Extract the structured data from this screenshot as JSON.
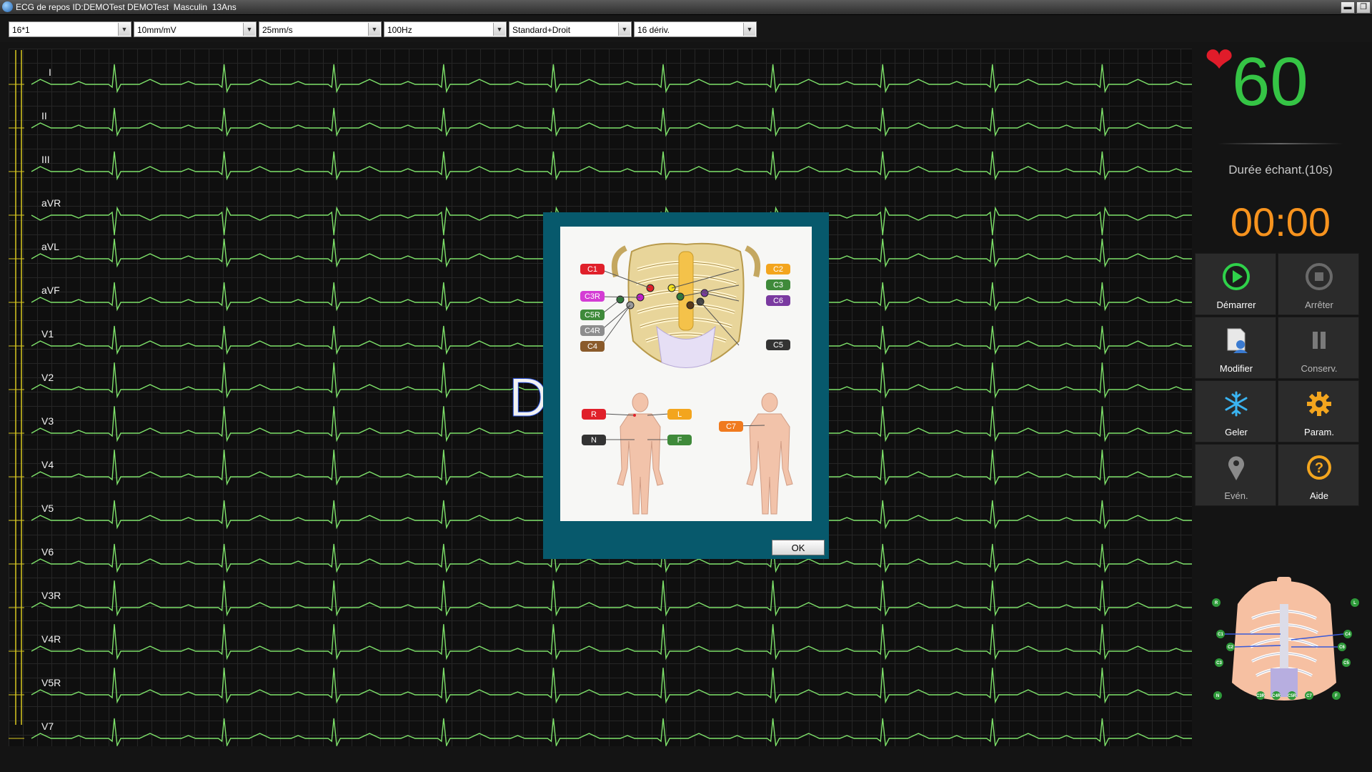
{
  "window": {
    "title": "ECG de repos ID:DEMOTest DEMOTest  Masculin  13Ans",
    "minimize_icon": "minimize-icon",
    "maximize_icon": "maximize-icon"
  },
  "toolbar": {
    "combos": [
      {
        "value": "16*1"
      },
      {
        "value": "10mm/mV"
      },
      {
        "value": "25mm/s"
      },
      {
        "value": "100Hz"
      },
      {
        "value": "Standard+Droit"
      },
      {
        "value": "16 dériv."
      }
    ]
  },
  "ecg": {
    "leads": [
      "I",
      "II",
      "III",
      "aVR",
      "aVL",
      "aVF",
      "V1",
      "V2",
      "V3",
      "V4",
      "V5",
      "V6",
      "V3R",
      "V4R",
      "V5R",
      "V7"
    ],
    "trace_color": "#7ee26a"
  },
  "overlay_text": "D",
  "modal": {
    "ok_label": "OK",
    "chest_labels": {
      "C1": "C1",
      "C2": "C2",
      "C3": "C3",
      "C3R": "C3R",
      "C4": "C4",
      "C4R": "C4R",
      "C5": "C5",
      "C5R": "C5R",
      "C6": "C6",
      "C7": "C7"
    },
    "limb_labels": {
      "R": "R",
      "L": "L",
      "N": "N",
      "F": "F"
    }
  },
  "status": {
    "heart_rate": "60",
    "heart_icon": "heart-icon",
    "duration_label": "Durée échant.(10s)",
    "timer": "00:00"
  },
  "buttons": [
    {
      "label": "Démarrer",
      "icon": "play-icon"
    },
    {
      "label": "Arrêter",
      "icon": "stop-icon"
    },
    {
      "label": "Modifier",
      "icon": "edit-user-icon"
    },
    {
      "label": "Conserv.",
      "icon": "pause-icon"
    },
    {
      "label": "Geler",
      "icon": "snowflake-icon"
    },
    {
      "label": "Param.",
      "icon": "gear-icon"
    },
    {
      "label": "Evén.",
      "icon": "location-pin-icon"
    },
    {
      "label": "Aide",
      "icon": "help-icon"
    }
  ],
  "electrode_map": {
    "labels": [
      "R",
      "L",
      "C1",
      "C4",
      "C2",
      "C6",
      "C3",
      "C5",
      "N",
      "C3R",
      "C4R",
      "C5R",
      "C7",
      "F"
    ]
  },
  "colors": {
    "accent_green": "#35c445",
    "timer_orange": "#f7931e",
    "modal_teal": "#07596c",
    "heart_red": "#e01c2a"
  }
}
